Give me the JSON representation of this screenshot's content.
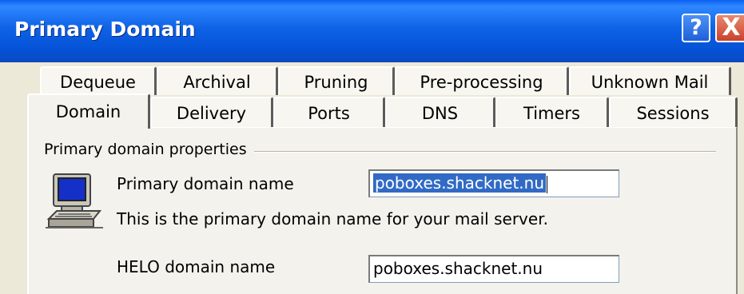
{
  "window": {
    "title": "Primary Domain",
    "help_label": "?",
    "close_label": "X"
  },
  "tabs": {
    "row1": [
      "Dequeue",
      "Archival",
      "Pruning",
      "Pre-processing",
      "Unknown Mail"
    ],
    "row2": [
      "Domain",
      "Delivery",
      "Ports",
      "DNS",
      "Timers",
      "Sessions"
    ],
    "active": "Domain"
  },
  "group": {
    "label": "Primary domain properties",
    "icon": "computer-icon"
  },
  "fields": {
    "primary_label": "Primary domain name",
    "primary_value": "poboxes.shacknet.nu",
    "primary_help": "This is the primary domain name for your mail server.",
    "helo_label": "HELO domain name",
    "helo_value": "poboxes.shacknet.nu"
  },
  "colors": {
    "titlebar": "#0552D6",
    "selection": "#316AC5",
    "face": "#ECE9D8"
  }
}
